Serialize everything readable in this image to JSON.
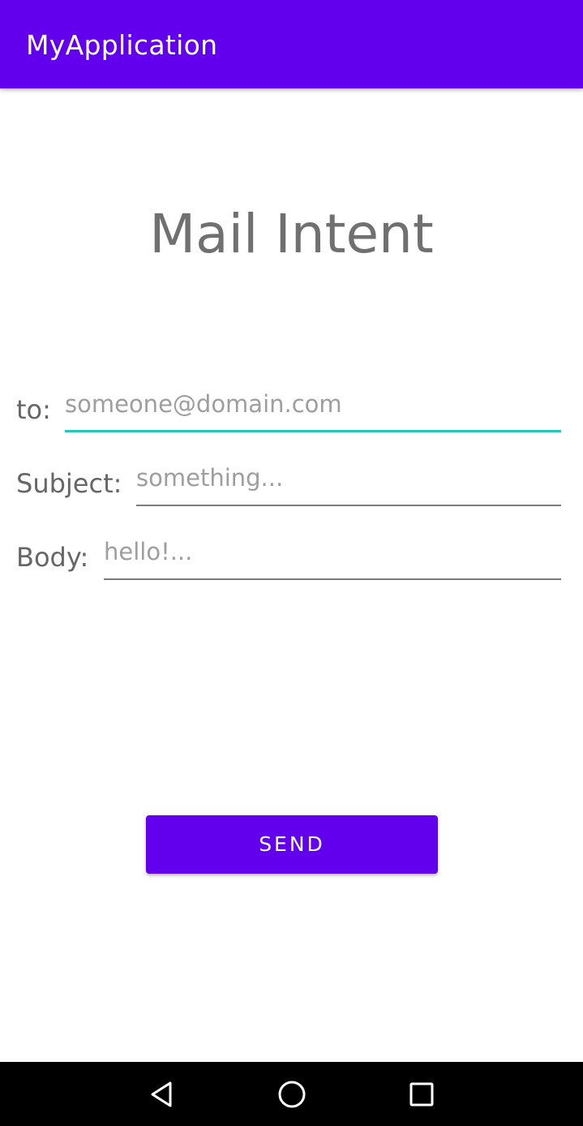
{
  "app_bar": {
    "title": "MyApplication",
    "color": "#6200ee"
  },
  "main": {
    "heading": "Mail Intent",
    "fields": [
      {
        "label": "to:",
        "placeholder": "someone@domain.com",
        "value": "",
        "focused": true
      },
      {
        "label": "Subject:",
        "placeholder": "something...",
        "value": "",
        "focused": false
      },
      {
        "label": "Body:",
        "placeholder": "hello!...",
        "value": "",
        "focused": false
      }
    ],
    "send_label": "SEND",
    "accent_color": "#26c6b6"
  },
  "nav_bar": {
    "buttons": [
      {
        "name": "back",
        "icon": "back-triangle-icon"
      },
      {
        "name": "home",
        "icon": "home-circle-icon"
      },
      {
        "name": "recents",
        "icon": "recents-square-icon"
      }
    ]
  }
}
